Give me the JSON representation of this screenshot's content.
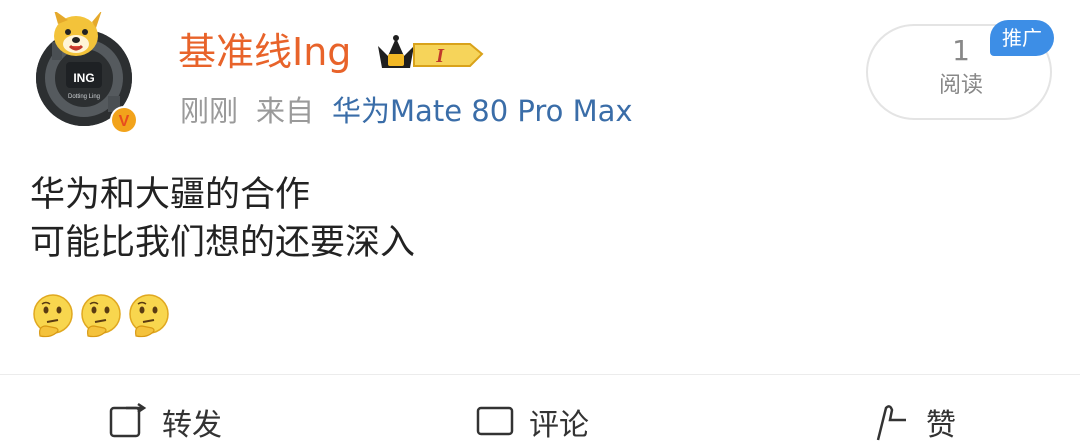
{
  "user": {
    "name": "基准线Ing",
    "vip_level": "I",
    "avatar_text": "ING",
    "avatar_subtext": "Dotting Ling",
    "verified_mark": "V"
  },
  "meta": {
    "time": "刚刚",
    "source_prefix": "来自",
    "device": "华为Mate 80 Pro Max"
  },
  "stats": {
    "read_count": "1",
    "read_label": "阅读",
    "promo_label": "推广"
  },
  "post": {
    "lines": [
      "华为和大疆的合作",
      "可能比我们想的还要深入"
    ],
    "emojis": [
      "thinking-face-icon",
      "thinking-face-icon",
      "thinking-face-icon"
    ]
  },
  "actions": {
    "repost": "转发",
    "comment": "评论",
    "like": "赞"
  },
  "colors": {
    "username": "#e8632a",
    "device": "#3a6da8",
    "meta": "#9a9a9a",
    "promo": "#3d8ee6",
    "vip_gold": "#f2b825"
  }
}
